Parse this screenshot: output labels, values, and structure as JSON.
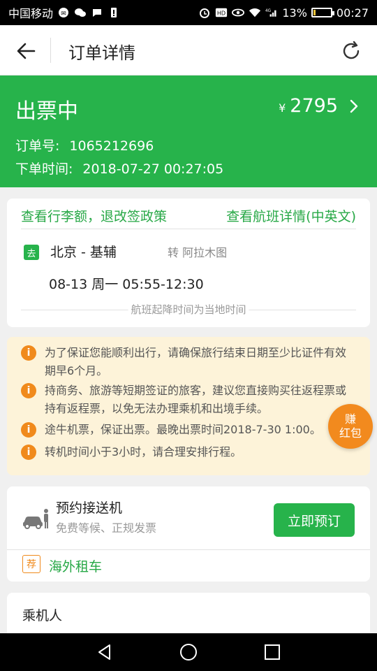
{
  "statusbar": {
    "carrier": "中国移动",
    "network": "4G",
    "battery": "13%",
    "battery_level": 0.13,
    "time": "00:27"
  },
  "titlebar": {
    "title": "订单详情",
    "back_icon": "arrow-left-icon",
    "refresh_icon": "refresh-icon"
  },
  "order": {
    "status": "出票中",
    "currency": "¥",
    "price": "2795",
    "order_no_label": "订单号:",
    "order_no": "1065212696",
    "time_label": "下单时间:",
    "time": "2018-07-27 00:27:05"
  },
  "flight": {
    "link_policy": "查看行李额，退改签政策",
    "link_detail": "查看航班详情(中英文)",
    "direction_badge": "去",
    "route": "北京 - 基辅",
    "transfer": "转 阿拉木图",
    "datetime": "08-13 周一 05:55-12:30",
    "note": "航班起降时间为当地时间"
  },
  "notices": [
    "为了保证您能顺利出行，请确保旅行结束日期至少比证件有效期早6个月。",
    "持商务、旅游等短期签证的旅客，建议您直接购买往返程票或持有返程票，以免无法办理乘机和出境手续。",
    "途牛机票，保证出票。最晚出票时间2018-7-30 1:00。",
    "转机时间小于3小时，请合理安排行程。"
  ],
  "redpacket": {
    "line1": "赚",
    "line2": "红包"
  },
  "transfer_service": {
    "title": "预约接送机",
    "subtitle": "免费等候、正规发票",
    "button": "立即预订",
    "rec_badge": "荐",
    "rec_label": "海外租车"
  },
  "passenger": {
    "title": "乘机人"
  },
  "colors": {
    "brand_green": "#27b34b",
    "notice_bg": "#fdf3d9",
    "info_orange": "#f08a1c"
  }
}
